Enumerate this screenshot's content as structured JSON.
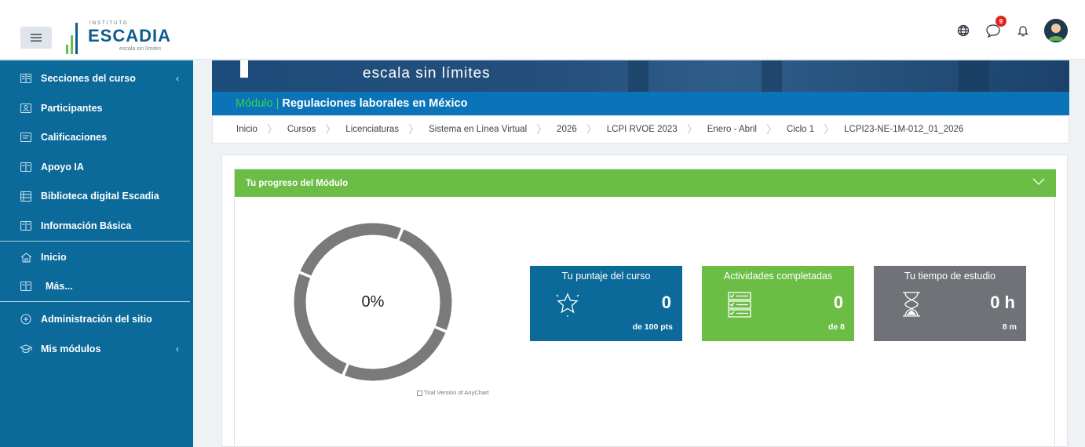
{
  "navbar": {
    "menu_icon": "hamburger-icon",
    "logo_top": "INSTITUTO",
    "logo_name": "ESCADIA",
    "logo_tag": "escala sin límites",
    "icons": [
      "globe-icon",
      "chat-icon",
      "bell-icon"
    ],
    "message_badge": "9"
  },
  "sidebar": {
    "items": [
      {
        "label": "Secciones del curso",
        "icon": "book-icon",
        "chevron": "‹"
      },
      {
        "label": "Participantes",
        "icon": "users-icon"
      },
      {
        "label": "Calificaciones",
        "icon": "grades-icon"
      },
      {
        "label": "Apoyo IA",
        "icon": "book-icon"
      },
      {
        "label": "Biblioteca digital Escadia",
        "icon": "library-icon"
      },
      {
        "label": "Información Básica",
        "icon": "book-icon"
      },
      {
        "label": "Inicio",
        "icon": "home-icon"
      },
      {
        "label": "Más...",
        "icon": "book-icon"
      },
      {
        "label": "Administración del sitio",
        "icon": "plus-circle-icon"
      },
      {
        "label": "Mis módulos",
        "icon": "graduation-icon",
        "chevron": "‹"
      }
    ]
  },
  "banner": {
    "text": "escala sin límites"
  },
  "module": {
    "label": "Módulo",
    "separator": "|",
    "name": "Regulaciones laborales en México"
  },
  "breadcrumb": [
    "Inicio",
    "Cursos",
    "Licenciaturas",
    "Sistema en Línea Virtual",
    "2026",
    "LCPI RVOE 2023",
    "Enero - Abril",
    "Ciclo 1",
    "LCPI23-NE-1M-012_01_2026"
  ],
  "progress": {
    "title": "Tu progreso del Módulo",
    "percent_label": "0%",
    "percent": 0,
    "trial_text": "Trial Version of AnyChart"
  },
  "stats": [
    {
      "title": "Tu puntaje del curso",
      "value": "0",
      "sub": "de 100 pts",
      "color": "#0b6a99",
      "icon": "star-icon"
    },
    {
      "title": "Actividades completadas",
      "value": "0",
      "sub": "de 8",
      "color": "#6cbd45",
      "icon": "checklist-icon"
    },
    {
      "title": "Tu tiempo de estudio",
      "value": "0 h",
      "sub": "8 m",
      "color": "#6f7378",
      "icon": "hourglass-icon"
    }
  ],
  "colors": {
    "sidebar": "#0b6a99",
    "module_bar": "#0b74b8",
    "progress_header": "#6cbd45",
    "donut_ring": "#7a7a7a",
    "badge": "#e2231a"
  }
}
